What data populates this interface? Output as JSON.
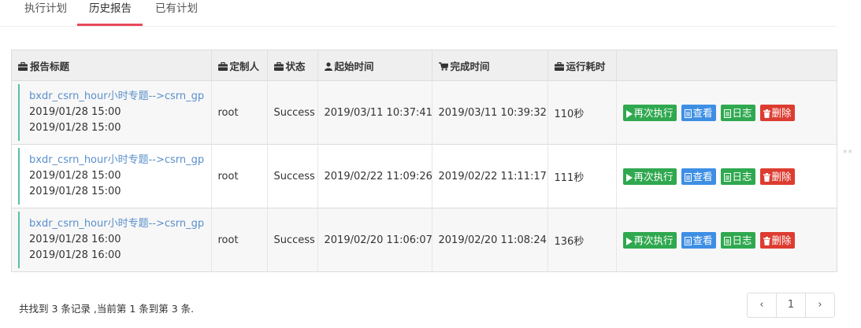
{
  "tabs": [
    {
      "label": "执行计划"
    },
    {
      "label": "历史报告"
    },
    {
      "label": "已有计划"
    }
  ],
  "active_tab": "历史报告",
  "table": {
    "headers": {
      "title": "报告标题",
      "owner": "定制人",
      "status": "状态",
      "start": "起始时间",
      "finish": "完成时间",
      "duration": "运行耗时"
    },
    "rows": [
      {
        "title": "bxdr_csrn_hour小时专题-->csrn_gp",
        "line1": "2019/01/28 15:00",
        "line2": "2019/01/28 15:00",
        "owner": "root",
        "status": "Success",
        "start": "2019/03/11 10:37:41",
        "finish": "2019/03/11 10:39:32",
        "duration": "110秒"
      },
      {
        "title": "bxdr_csrn_hour小时专题-->csrn_gp",
        "line1": "2019/01/28 15:00",
        "line2": "2019/01/28 15:00",
        "owner": "root",
        "status": "Success",
        "start": "2019/02/22 11:09:26",
        "finish": "2019/02/22 11:11:17",
        "duration": "111秒"
      },
      {
        "title": "bxdr_csrn_hour小时专题-->csrn_gp",
        "line1": "2019/01/28 16:00",
        "line2": "2019/01/28 16:00",
        "owner": "root",
        "status": "Success",
        "start": "2019/02/20 11:06:07",
        "finish": "2019/02/20 11:08:24",
        "duration": "136秒"
      }
    ],
    "actions": {
      "rerun": "再次执行",
      "view": "查看",
      "log": "日志",
      "delete": "删除"
    }
  },
  "footer": {
    "summary": "共找到 3 条记录 ,当前第 1 条到第 3 条."
  },
  "pagination": {
    "prev": "‹",
    "page": "1",
    "next": "›"
  },
  "side_marker": "**",
  "colors": {
    "accent_tab": "#e8495b",
    "link": "#5a8fcb",
    "row_bar": "#56c0a8",
    "btn_green": "#2fa84f",
    "btn_blue": "#3e8fe4",
    "btn_red": "#dd3c30"
  },
  "icons": {
    "header_title": "briefcase-icon",
    "header_owner": "briefcase-icon",
    "header_status": "briefcase-icon",
    "header_start": "user-icon",
    "header_finish": "cart-icon",
    "header_duration": "briefcase-icon",
    "rerun": "play-icon",
    "view": "document-icon",
    "log": "document-icon",
    "delete": "trash-icon"
  }
}
